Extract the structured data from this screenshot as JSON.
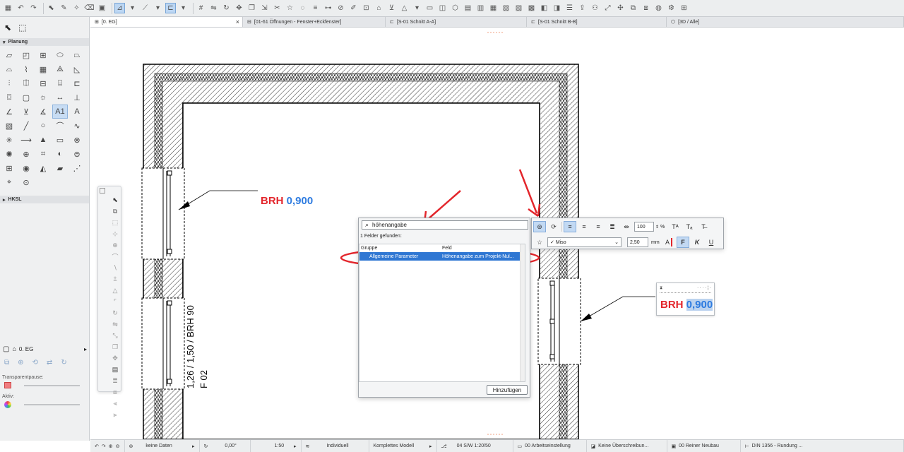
{
  "tabs": [
    {
      "label": "[0. EG]",
      "active": true
    },
    {
      "label": "[01-61 Öffnungen - Fenster+Eckfenster]"
    },
    {
      "label": "[S-01 Schnitt A-A]"
    },
    {
      "label": "[S-01 Schnitt B-B]"
    },
    {
      "label": "[3D / Alle]"
    }
  ],
  "sidebar": {
    "section_planung": "Planung",
    "section_hksl": "HKSL",
    "story": "0. EG",
    "transparent_label": "Transparentpause:",
    "active_label": "Aktiv:",
    "tool_label_a1": "A1"
  },
  "drawing": {
    "brh_left_key": "BRH",
    "brh_left_value": "0,900",
    "brh_right_key": "BRH",
    "brh_right_value": "0,900",
    "window_label_line1": "1,26 / 1,50 / BRH 90",
    "window_label_line2": "F 02"
  },
  "field_dialog": {
    "search_value": "höhenangabe",
    "found_text": "1 Felder gefunden:",
    "col_group": "Gruppe",
    "col_field": "Feld",
    "row_group": "Allgemeine Parameter",
    "row_field": "Höhenangabe zum Projekt-Nul...",
    "add_button": "Hinzufügen"
  },
  "text_toolbar": {
    "scale_value": "100",
    "percent": "%",
    "font_name": "Miso",
    "size_value": "2,50",
    "unit": "mm",
    "bold": "F",
    "italic": "K",
    "underline": "U"
  },
  "status": {
    "no_data": "keine Daten",
    "angle": "0,00°",
    "scale": "1:50",
    "individual": "Individuell",
    "model": "Komplettes Modell",
    "pen_set": "04 S/W 1:20/50",
    "work_setting": "00 Arbeitseinstellung",
    "override": "Keine Überschreibun...",
    "renovation": "00 Reiner Neubau",
    "din": "DIN 1356 - Rundung ..."
  },
  "colors": {
    "accent_blue": "#2d7be0",
    "annotation_red": "#e3262c",
    "selection_blue": "#2f77d3"
  }
}
